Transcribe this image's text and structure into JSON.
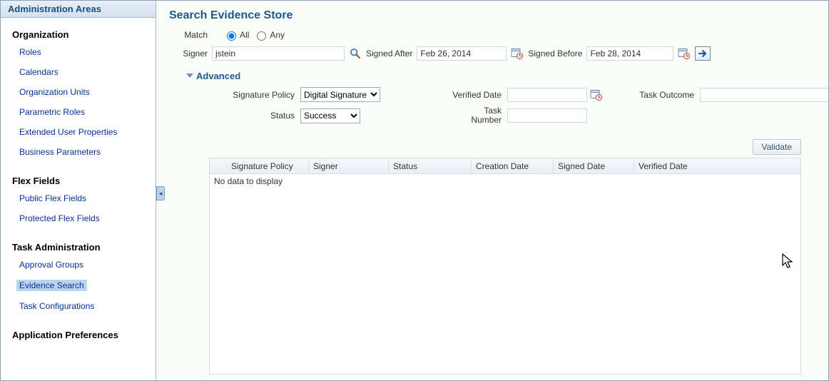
{
  "sidebar": {
    "title": "Administration Areas",
    "sections": [
      {
        "title": "Organization",
        "items": [
          "Roles",
          "Calendars",
          "Organization Units",
          "Parametric Roles",
          "Extended User Properties",
          "Business Parameters"
        ]
      },
      {
        "title": "Flex Fields",
        "items": [
          "Public Flex Fields",
          "Protected Flex Fields"
        ]
      },
      {
        "title": "Task Administration",
        "items": [
          "Approval Groups",
          "Evidence Search",
          "Task Configurations"
        ]
      },
      {
        "title": "Application Preferences",
        "items": []
      }
    ],
    "selected": "Evidence Search"
  },
  "content": {
    "title": "Search Evidence Store",
    "match": {
      "label": "Match",
      "options": [
        "All",
        "Any"
      ],
      "value": "All"
    },
    "signer": {
      "label": "Signer",
      "value": "jstein"
    },
    "signed_after": {
      "label": "Signed After",
      "value": "Feb 26, 2014"
    },
    "signed_before": {
      "label": "Signed Before",
      "value": "Feb 28, 2014"
    },
    "advanced": {
      "title": "Advanced",
      "signature_policy": {
        "label": "Signature Policy",
        "value": "Digital Signature",
        "options": [
          "Digital Signature"
        ]
      },
      "status": {
        "label": "Status",
        "value": "Success",
        "options": [
          "Success"
        ]
      },
      "verified_date": {
        "label": "Verified Date",
        "value": ""
      },
      "task_number": {
        "label": "Task Number",
        "value": ""
      },
      "task_outcome": {
        "label": "Task Outcome",
        "value": ""
      }
    },
    "validate_label": "Validate",
    "table": {
      "columns": [
        "Signature Policy",
        "Signer",
        "Status",
        "Creation Date",
        "Signed Date",
        "Verified Date"
      ],
      "empty": "No data to display"
    }
  }
}
